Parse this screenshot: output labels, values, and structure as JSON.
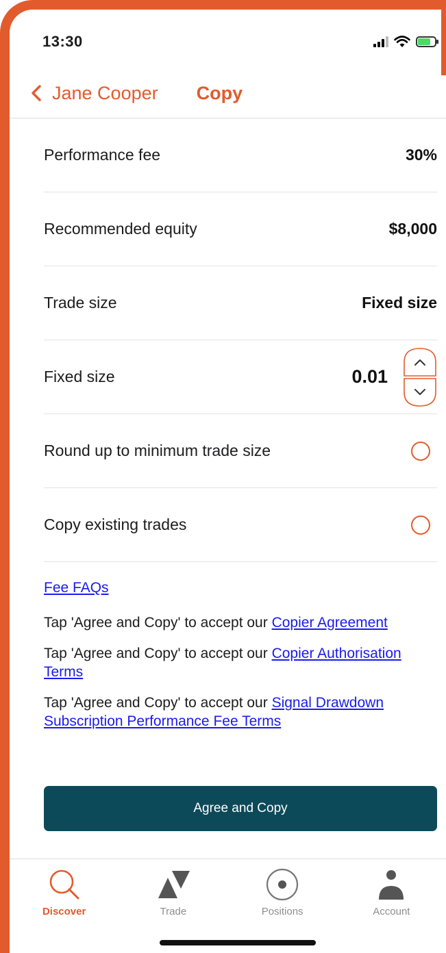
{
  "status_bar": {
    "time": "13:30"
  },
  "nav": {
    "back_label": "Jane Cooper",
    "title": "Copy"
  },
  "rows": {
    "performance_fee": {
      "label": "Performance fee",
      "value": "30%"
    },
    "recommended_equity": {
      "label": "Recommended equity",
      "value": "$8,000"
    },
    "trade_size": {
      "label": "Trade size",
      "value": "Fixed size"
    },
    "fixed_size": {
      "label": "Fixed size",
      "value": "0.01"
    },
    "round_up": {
      "label": "Round up to minimum trade size",
      "checked": false
    },
    "copy_existing": {
      "label": "Copy existing trades",
      "checked": false
    }
  },
  "links": {
    "fee_faqs": "Fee FAQs",
    "prefix": "Tap 'Agree and Copy' to accept our",
    "copier_agreement": "Copier Agreement",
    "copier_authorisation": "Copier Authorisation Terms",
    "signal_drawdown": "Signal Drawdown Subscription Performance Fee Terms"
  },
  "agree_button": "Agree and Copy",
  "tabs": [
    {
      "label": "Discover",
      "icon": "search-icon",
      "active": true
    },
    {
      "label": "Trade",
      "icon": "triangles-icon",
      "active": false
    },
    {
      "label": "Positions",
      "icon": "target-icon",
      "active": false
    },
    {
      "label": "Account",
      "icon": "person-icon",
      "active": false
    }
  ],
  "colors": {
    "accent": "#e25b2c",
    "button": "#0d4a59",
    "link": "#1a1aee",
    "inactive_tab": "#8e8e93"
  }
}
